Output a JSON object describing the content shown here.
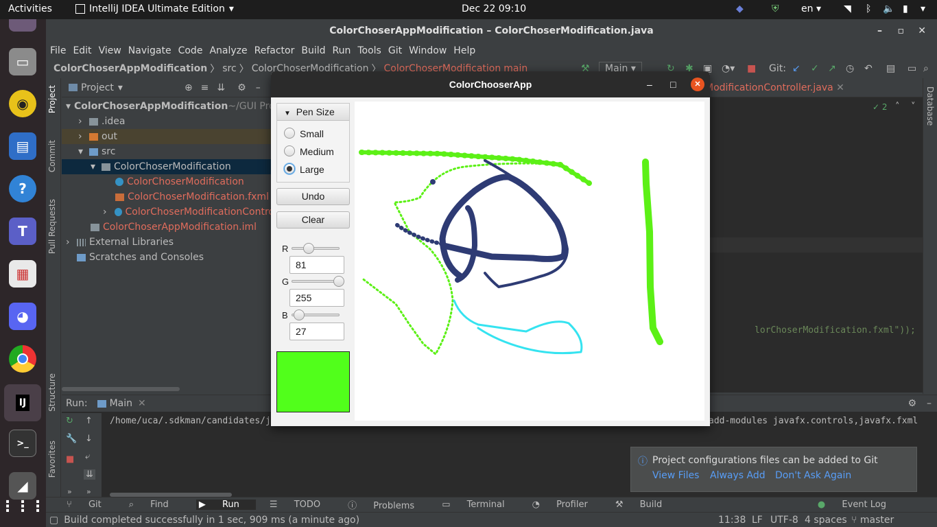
{
  "topbar": {
    "activities": "Activities",
    "app": "IntelliJ IDEA Ultimate Edition",
    "datetime": "Dec 22  09:10",
    "lang": "en"
  },
  "ide": {
    "title": "ColorChoserAppModification – ColorChoserModification.java",
    "menu": [
      "File",
      "Edit",
      "View",
      "Navigate",
      "Code",
      "Analyze",
      "Refactor",
      "Build",
      "Run",
      "Tools",
      "Git",
      "Window",
      "Help"
    ],
    "breadcrumbs": [
      "ColorChoserAppModification",
      "src",
      "ColorChoserModification",
      "ColorChoserModification",
      "main"
    ],
    "run_config": "Main",
    "git_label": "Git:",
    "editor_tab": "ModificationController.java",
    "editor_line": "lorChoserModification.fxml\"));",
    "inspection_count": "2",
    "project_label": "Project",
    "tree": [
      {
        "text": "ColorChoserAppModification",
        "suffix": " ~/GUI Pro"
      },
      {
        "text": ".idea"
      },
      {
        "text": "out"
      },
      {
        "text": "src"
      },
      {
        "text": "ColorChoserModification"
      },
      {
        "text": "ColorChoserModification"
      },
      {
        "text": "ColorChoserModification.fxml"
      },
      {
        "text": "ColorChoserModificationContro"
      },
      {
        "text": "ColorChoserAppModification.iml"
      },
      {
        "text": "External Libraries"
      },
      {
        "text": "Scratches and Consoles"
      }
    ],
    "left_tabs": [
      "Project",
      "Commit",
      "Pull Requests",
      "Structure",
      "Favorites"
    ],
    "right_tabs": [
      "Database"
    ],
    "run": {
      "label": "Run:",
      "tab": "Main",
      "cmd_left": "/home/uca/.sdkman/candidates/j",
      "cmd_right": "add-modules javafx.controls,javafx.fxml"
    },
    "bottom_tabs": [
      "Git",
      "Find",
      "Run",
      "TODO",
      "Problems",
      "Terminal",
      "Profiler",
      "Build"
    ],
    "event_log": "Event Log",
    "status": {
      "message": "Build completed successfully in 1 sec, 909 ms (a minute ago)",
      "pos": "11:38",
      "lf": "LF",
      "enc": "UTF-8",
      "indent": "4 spaces",
      "branch": "master"
    },
    "notification": {
      "text": "Project configurations files can be added to Git",
      "actions": [
        "View Files",
        "Always Add",
        "Don't Ask Again"
      ]
    }
  },
  "dialog": {
    "title": "ColorChooserApp",
    "pen_title": "Pen Size",
    "sizes": [
      "Small",
      "Medium",
      "Large"
    ],
    "selected_size": "Large",
    "undo": "Undo",
    "clear": "Clear",
    "r_label": "R",
    "g_label": "G",
    "b_label": "B",
    "r": "81",
    "g": "255",
    "b": "27",
    "preview_color": "#51ff1b"
  },
  "colors": {
    "ide_bg": "#3c3f41",
    "editor_bg": "#2b2b2b",
    "link": "#589df6",
    "file_red": "#e06c5c",
    "stroke_green": "#5cf016",
    "stroke_navy": "#2e3b74",
    "stroke_cyan": "#35e3f0"
  }
}
